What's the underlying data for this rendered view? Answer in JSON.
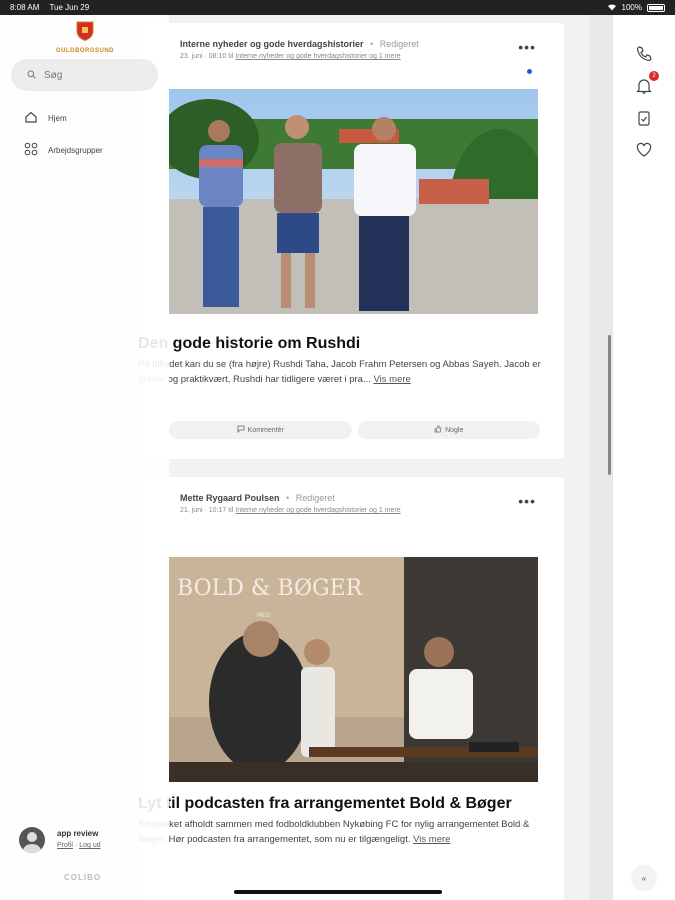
{
  "status_bar": {
    "time": "8:08 AM",
    "date": "Tue Jun 29",
    "battery": "100%"
  },
  "sidebar": {
    "logo_text": "GULDBORGSUND",
    "search_placeholder": "Søg",
    "nav": [
      {
        "label": "Hjem",
        "icon": "home-icon"
      },
      {
        "label": "Arbejdsgrupper",
        "icon": "groups-icon"
      }
    ],
    "user": {
      "name": "app review",
      "profile_link": "Profil",
      "logout_link": "Log ud",
      "link_separator": "·"
    },
    "brand": "COLIBO"
  },
  "posts": [
    {
      "author": "Interne nyheder og gode hverdagshistorier",
      "separator": "•",
      "edited": "Redigeret",
      "date": "23. juni · 08:10",
      "to_prefix": "til",
      "to": "Interne nyheder og gode hverdagshistorier og 1 mere",
      "title": "Den gode historie om Rushdi",
      "excerpt": "På billedet kan du se (fra højre) Rushdi Taha, Jacob Frahm Petersen og Abbas Sayeh. Jacob er graver og praktikvært, Rushdi har tidligere været i pra...",
      "see_more": "Vis mere",
      "comment_label": "Kommentér",
      "like_label": "Nogle"
    },
    {
      "author": "Mette Rygaard Poulsen",
      "separator": "•",
      "edited": "Redigeret",
      "date": "21. juni · 10:17",
      "to_prefix": "til",
      "to": "Interne nyheder og gode hverdagshistorier og 1 mere",
      "title": "Lyt til podcasten fra arrangementet Bold & Bøger",
      "excerpt": "Biblioteket afholdt sammen med fodboldklubben Nykøbing FC for nylig arrangementet Bold & Bøger. Hør podcasten fra arrangementet, som nu er tilgængeligt.",
      "see_more": "Vis mere",
      "banner_text": "BOLD & BØGER",
      "banner_sub": "MED\nJEN GAVIDSEN OG      STARBIRG"
    }
  ],
  "right_rail": {
    "notification_count": "2",
    "collapse_label": "«"
  },
  "colors": {
    "accent_red": "#d52b2b",
    "unread_blue": "#1a5fd6",
    "logo_gold": "#c28a1a"
  }
}
